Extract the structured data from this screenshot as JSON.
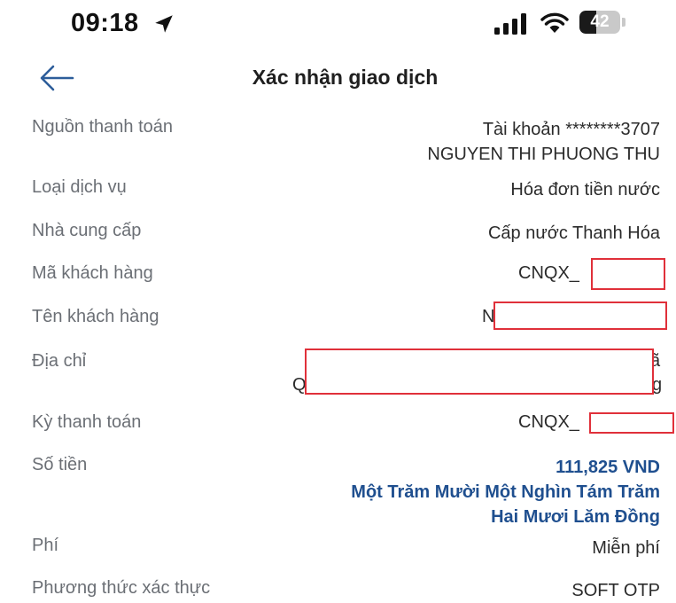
{
  "status_bar": {
    "time": "09:18",
    "battery": "42",
    "battery_level": 0.42
  },
  "header": {
    "title": "Xác nhận giao dịch"
  },
  "details": {
    "source": {
      "label": "Nguồn thanh toán",
      "value_line1": "Tài khoản ********3707",
      "value_line2": "NGUYEN THI PHUONG THU"
    },
    "service_type": {
      "label": "Loại dịch vụ",
      "value": "Hóa đơn tiền nước"
    },
    "provider": {
      "label": "Nhà cung cấp",
      "value": "Cấp nước Thanh Hóa"
    },
    "customer_code": {
      "label": "Mã khách hàng",
      "value_prefix": "CNQX_"
    },
    "customer_name": {
      "label": "Tên khách hàng",
      "value_prefix": "N"
    },
    "address": {
      "label": "Địa chỉ",
      "visible_start": "Q",
      "visible_end_line1": "ã",
      "visible_end_line2": "g"
    },
    "billing_period": {
      "label": "Kỳ thanh toán",
      "value_prefix": "CNQX_"
    },
    "amount": {
      "label": "Số tiền",
      "value": "111,825 VND",
      "words_line1": "Một Trăm Mười Một Nghìn Tám Trăm",
      "words_line2": "Hai Mươi Lăm Đồng"
    },
    "fee": {
      "label": "Phí",
      "value": "Miễn phí"
    },
    "auth_method": {
      "label": "Phương thức xác thực",
      "value": "SOFT OTP"
    }
  },
  "colors": {
    "accent_blue": "#1f4f8f",
    "redaction_red": "#e0303a",
    "label_gray": "#6b6f75"
  }
}
